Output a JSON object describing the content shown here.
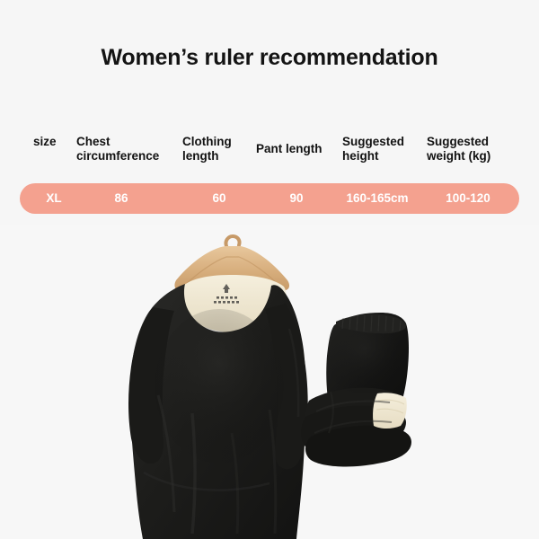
{
  "page": {
    "title": "Women’s ruler recommendation",
    "background_color": "#f6f6f6"
  },
  "size_table": {
    "accent_color": "#f4a18f",
    "row_text_color": "#ffffff",
    "headers": [
      "size",
      "Chest circumference",
      "Clothing length",
      "Pant length",
      "Suggested height",
      "Suggested weight (kg)"
    ],
    "rows": [
      {
        "size": "XL",
        "chest_circumference": "86",
        "clothing_length": "60",
        "pant_length": "90",
        "suggested_height": "160-165cm",
        "suggested_weight": "100-120"
      }
    ]
  },
  "product_photo": {
    "alt": "black thermal top on wooden hanger with folded black thermal pants",
    "garment_color": "#1c1c1c",
    "lining_color": "#efe7d2",
    "hanger_color": "#d9b282"
  }
}
